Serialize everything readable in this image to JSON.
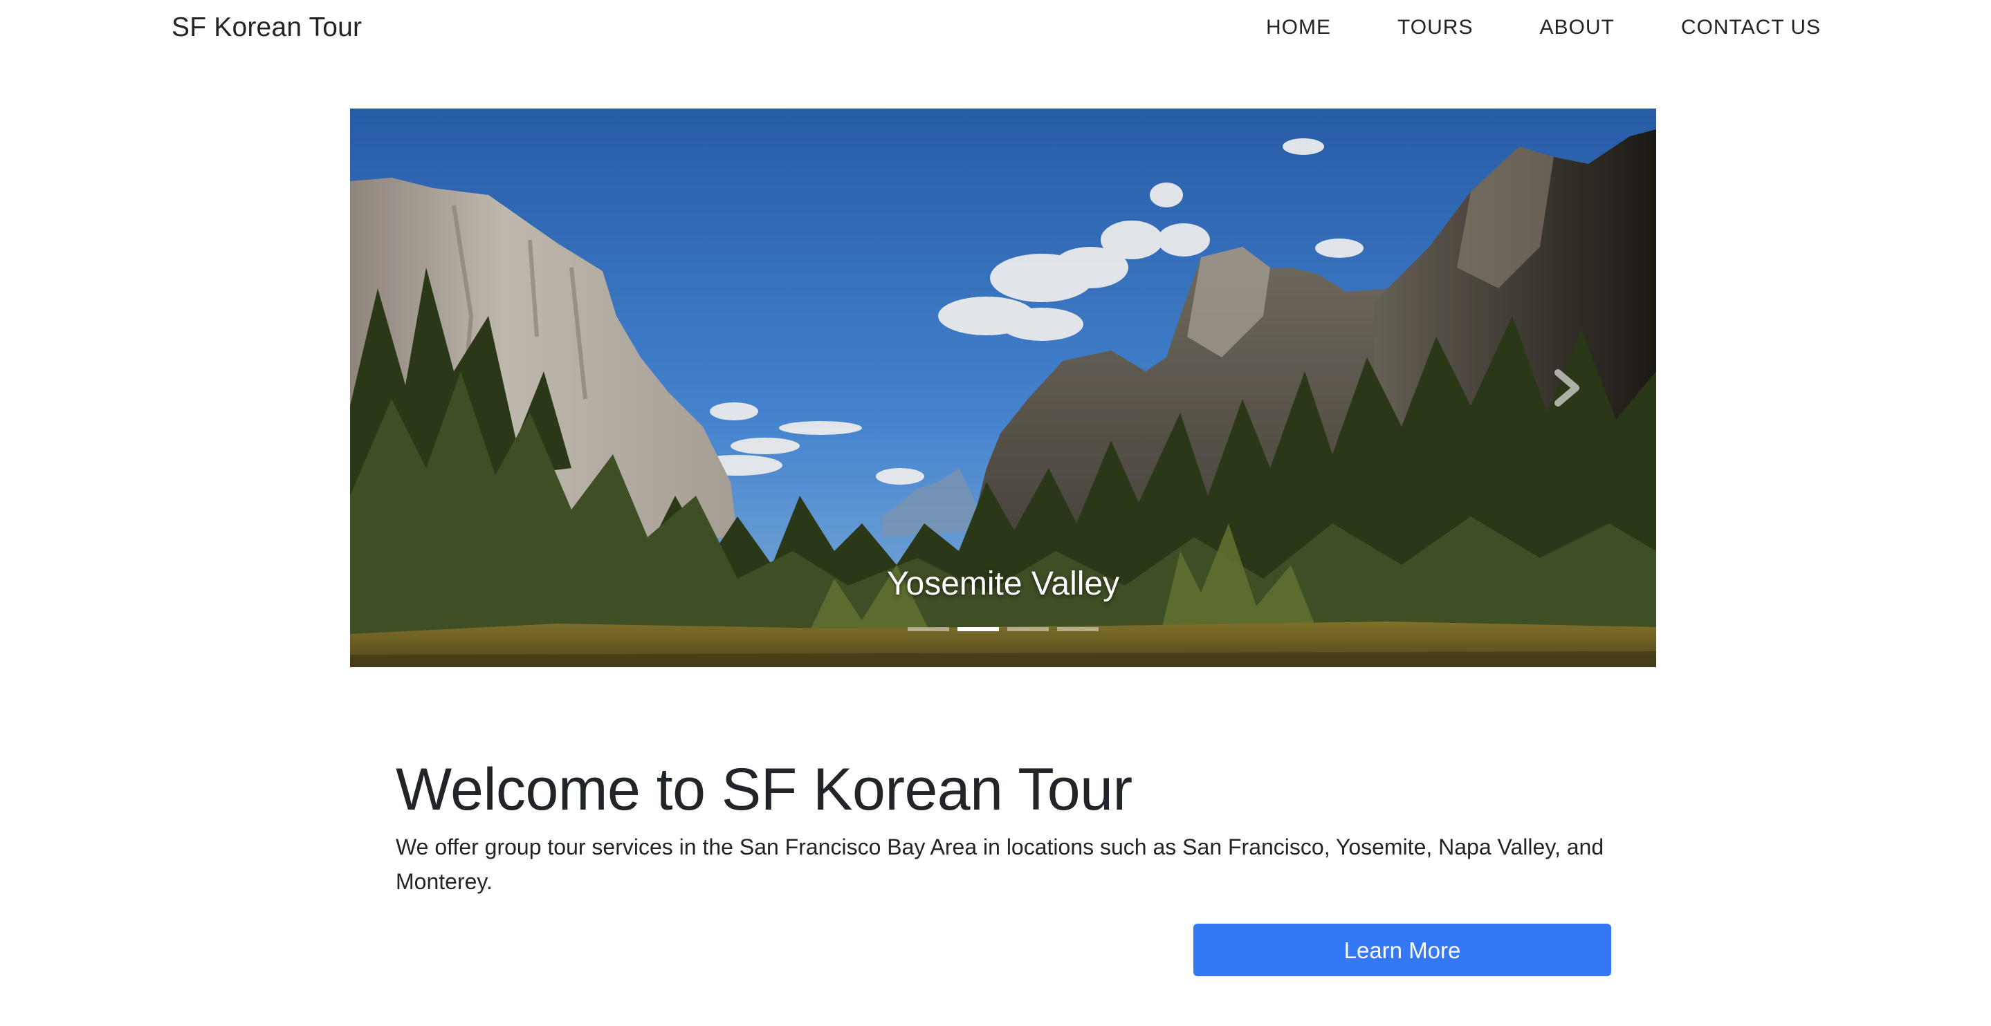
{
  "navbar": {
    "brand": "SF Korean Tour",
    "links": [
      "HOME",
      "TOURS",
      "ABOUT",
      "CONTACT US"
    ]
  },
  "carousel": {
    "caption": "Yosemite Valley",
    "slide_count": 4,
    "active_index": 1,
    "next_icon": "chevron-right-icon"
  },
  "welcome": {
    "title": "Welcome to SF Korean Tour",
    "text": "We offer group tour services in the San Francisco Bay Area in locations such as San Francisco, Yosemite, Napa Valley, and Monterey.",
    "button_label": "Learn More"
  },
  "colors": {
    "button": "#3478f6",
    "text": "#212529"
  }
}
